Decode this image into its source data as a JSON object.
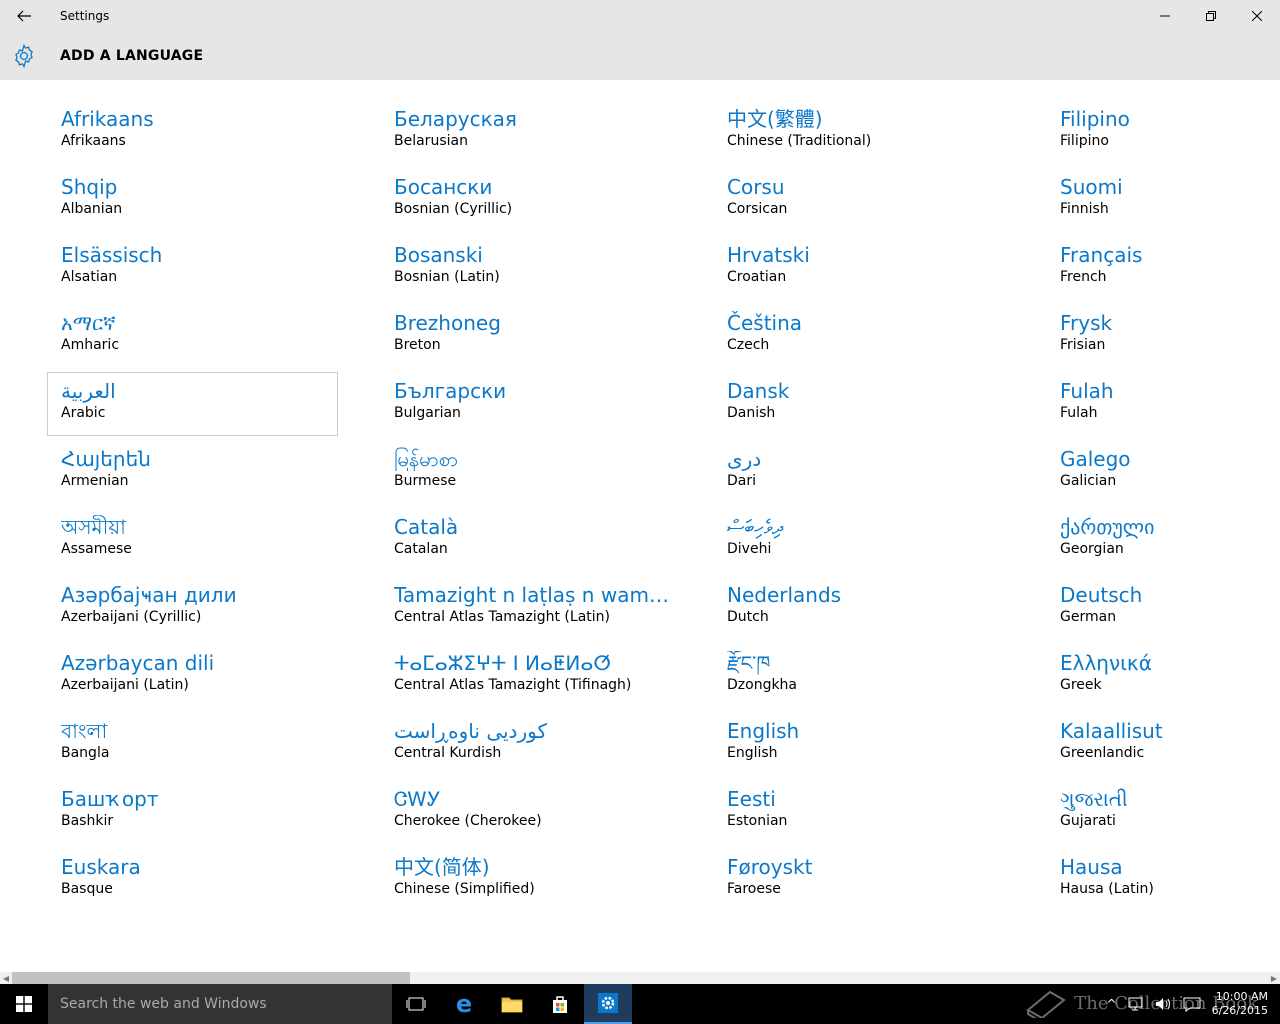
{
  "window": {
    "title": "Settings"
  },
  "header": {
    "title": "ADD A LANGUAGE"
  },
  "languages": [
    {
      "native": "Afrikaans",
      "english": "Afrikaans"
    },
    {
      "native": "Shqip",
      "english": "Albanian"
    },
    {
      "native": "Elsässisch",
      "english": "Alsatian"
    },
    {
      "native": "አማርኛ",
      "english": "Amharic"
    },
    {
      "native": "العربية",
      "english": "Arabic",
      "selected": true
    },
    {
      "native": "Հայերեն",
      "english": "Armenian"
    },
    {
      "native": "অসমীয়া",
      "english": "Assamese"
    },
    {
      "native": "Азәрбајҹан дили",
      "english": "Azerbaijani (Cyrillic)"
    },
    {
      "native": "Azərbaycan dili",
      "english": "Azerbaijani (Latin)"
    },
    {
      "native": "বাংলা",
      "english": "Bangla"
    },
    {
      "native": "Башҡорт",
      "english": "Bashkir"
    },
    {
      "native": "Euskara",
      "english": "Basque"
    },
    {
      "native": "Беларуская",
      "english": "Belarusian"
    },
    {
      "native": "Босански",
      "english": "Bosnian (Cyrillic)"
    },
    {
      "native": "Bosanski",
      "english": "Bosnian (Latin)"
    },
    {
      "native": "Brezhoneg",
      "english": "Breton"
    },
    {
      "native": "Български",
      "english": "Bulgarian"
    },
    {
      "native": "မြန်မာစာ",
      "english": "Burmese"
    },
    {
      "native": "Català",
      "english": "Catalan"
    },
    {
      "native": "Tamazight n laṭlaṣ n wamm...",
      "english": "Central Atlas Tamazight (Latin)"
    },
    {
      "native": "ⵜⴰⵎⴰⵣⵉⵖⵜ ⵏ ⵍⴰⵟⵍⴰⵚ",
      "english": "Central Atlas Tamazight (Tifinagh)"
    },
    {
      "native": "کوردیی ناوەڕاست",
      "english": "Central Kurdish"
    },
    {
      "native": "ᏣᎳᎩ",
      "english": "Cherokee (Cherokee)"
    },
    {
      "native": "中文(简体)",
      "english": "Chinese (Simplified)"
    },
    {
      "native": "中文(繁體)",
      "english": "Chinese (Traditional)"
    },
    {
      "native": "Corsu",
      "english": "Corsican"
    },
    {
      "native": "Hrvatski",
      "english": "Croatian"
    },
    {
      "native": "Čeština",
      "english": "Czech"
    },
    {
      "native": "Dansk",
      "english": "Danish"
    },
    {
      "native": "دری",
      "english": "Dari"
    },
    {
      "native": "ދިވެހިބަސް",
      "english": "Divehi"
    },
    {
      "native": "Nederlands",
      "english": "Dutch"
    },
    {
      "native": "རྫོང་ཁ",
      "english": "Dzongkha"
    },
    {
      "native": "English",
      "english": "English"
    },
    {
      "native": "Eesti",
      "english": "Estonian"
    },
    {
      "native": "Føroyskt",
      "english": "Faroese"
    },
    {
      "native": "Filipino",
      "english": "Filipino"
    },
    {
      "native": "Suomi",
      "english": "Finnish"
    },
    {
      "native": "Français",
      "english": "French"
    },
    {
      "native": "Frysk",
      "english": "Frisian"
    },
    {
      "native": "Fulah",
      "english": "Fulah"
    },
    {
      "native": "Galego",
      "english": "Galician"
    },
    {
      "native": "ქართული",
      "english": "Georgian"
    },
    {
      "native": "Deutsch",
      "english": "German"
    },
    {
      "native": "Ελληνικά",
      "english": "Greek"
    },
    {
      "native": "Kalaallisut",
      "english": "Greenlandic"
    },
    {
      "native": "ગુજરાતી",
      "english": "Gujarati"
    },
    {
      "native": "Hausa",
      "english": "Hausa (Latin)"
    }
  ],
  "taskbar": {
    "search_placeholder": "Search the web and Windows",
    "time": "10:00 AM",
    "date": "6/26/2015",
    "watermark": "The Collection Book"
  },
  "colors": {
    "accent": "#0c78c9",
    "header_bg": "#e6e6e6",
    "taskbar_bg": "#000000"
  }
}
